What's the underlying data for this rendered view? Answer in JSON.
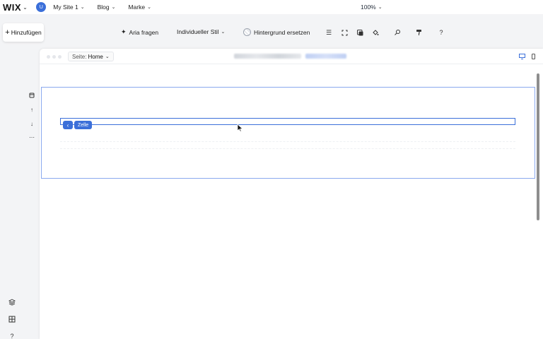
{
  "topbar": {
    "logo": "WIX",
    "avatar_initial": "U",
    "menu": [
      {
        "label": "My Site 1"
      },
      {
        "label": "Blog"
      },
      {
        "label": "Marke"
      }
    ],
    "zoom": "100%"
  },
  "toolbar": {
    "add_label": "Hinzufügen",
    "aria_label": "Aria fragen",
    "style_label": "Individueller Stil",
    "background_label": "Hintergrund ersetzen"
  },
  "canvas": {
    "page_prefix": "Seite:",
    "page_name": "Home",
    "cell_label": "Zelle"
  },
  "icons": {
    "add": "plus-icon",
    "aria": "sparkle-icon",
    "layout": "menu-icon",
    "crop": "crop-icon",
    "shadow": "shadow-icon",
    "fill": "paint-bucket-icon",
    "link": "link-icon",
    "format": "paint-roller-icon",
    "help": "question-icon",
    "layers": "layers-icon",
    "grid": "grid-icon",
    "desktop": "desktop-icon",
    "mobile": "mobile-icon"
  },
  "colors": {
    "accent": "#3b6fd9",
    "selection_border": "#8aa9ee"
  },
  "scroll": {
    "position_fraction": 0.0,
    "visible_fraction": 0.55
  }
}
